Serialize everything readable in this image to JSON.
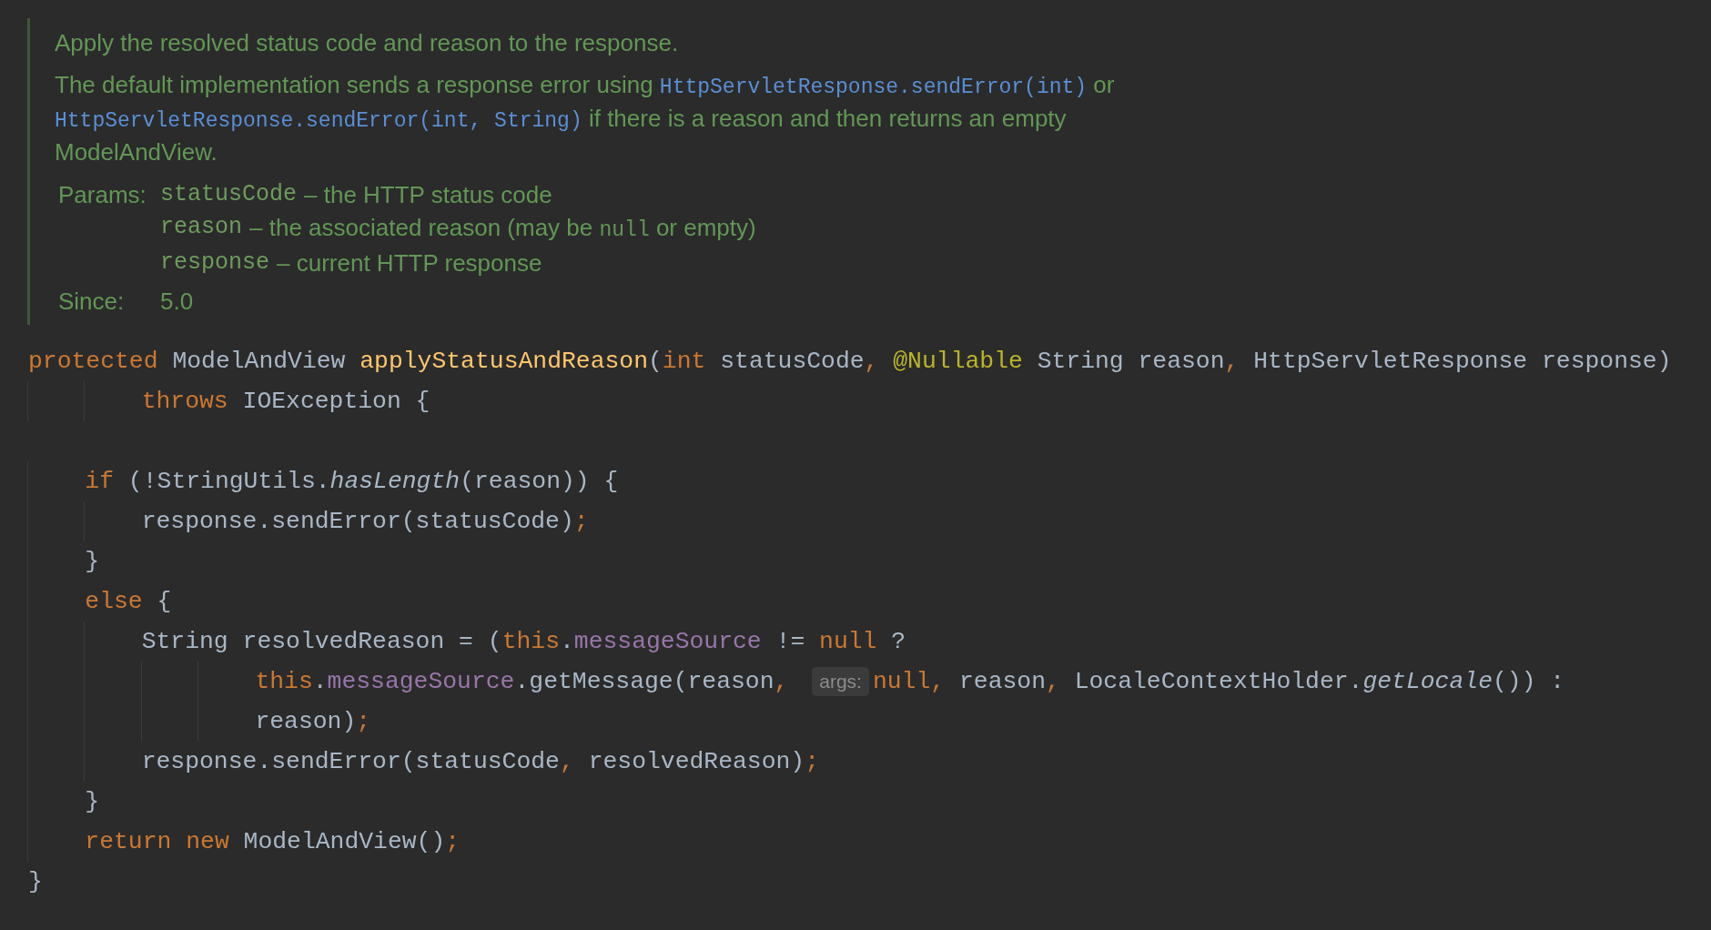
{
  "doc": {
    "summary": "Apply the resolved status code and reason to the response.",
    "description": [
      {
        "kind": "text",
        "text": "The default implementation sends a response error using "
      },
      {
        "kind": "link",
        "text": "HttpServletResponse.sendError(int)"
      },
      {
        "kind": "text",
        "text": " or "
      },
      {
        "kind": "link",
        "text": "HttpServletResponse.sendError(int, String)"
      },
      {
        "kind": "text",
        "text": " if there is a reason and then returns an empty ModelAndView."
      }
    ],
    "params_label": "Params:",
    "params": [
      {
        "name": "statusCode",
        "description": [
          {
            "kind": "text",
            "text": "– the HTTP status code"
          }
        ]
      },
      {
        "name": "reason",
        "description": [
          {
            "kind": "text",
            "text": "– the associated reason (may be "
          },
          {
            "kind": "code",
            "text": "null"
          },
          {
            "kind": "text",
            "text": " or empty)"
          }
        ]
      },
      {
        "name": "response",
        "description": [
          {
            "kind": "text",
            "text": "– current HTTP response"
          }
        ]
      }
    ],
    "since_label": "Since:",
    "since": "5.0"
  },
  "code_lines": [
    {
      "kind": "code",
      "tokens": [
        {
          "kind": "keyword",
          "text": "protected"
        },
        {
          "kind": "plain",
          "text": " ModelAndView "
        },
        {
          "kind": "declaration",
          "text": "applyStatusAndReason"
        },
        {
          "kind": "plain",
          "text": "("
        },
        {
          "kind": "keyword",
          "text": "int"
        },
        {
          "kind": "plain",
          "text": " statusCode"
        },
        {
          "kind": "punct",
          "text": ", "
        },
        {
          "kind": "annotation",
          "text": "@Nullable"
        },
        {
          "kind": "plain",
          "text": " String reason"
        },
        {
          "kind": "punct",
          "text": ", "
        },
        {
          "kind": "plain",
          "text": "HttpServletResponse response)"
        }
      ]
    },
    {
      "kind": "code",
      "tokens": [
        {
          "kind": "keyword",
          "text": "        throws"
        },
        {
          "kind": "plain",
          "text": " IOException {"
        }
      ]
    },
    {
      "kind": "blank"
    },
    {
      "kind": "code",
      "tokens": [
        {
          "kind": "keyword",
          "text": "    if"
        },
        {
          "kind": "plain",
          "text": " (!StringUtils."
        },
        {
          "kind": "static",
          "text": "hasLength"
        },
        {
          "kind": "plain",
          "text": "(reason)) {"
        }
      ]
    },
    {
      "kind": "code",
      "tokens": [
        {
          "kind": "plain",
          "text": "        response.sendError(statusCode)"
        },
        {
          "kind": "punct",
          "text": ";"
        }
      ]
    },
    {
      "kind": "code",
      "tokens": [
        {
          "kind": "plain",
          "text": "    }"
        }
      ]
    },
    {
      "kind": "code",
      "tokens": [
        {
          "kind": "keyword",
          "text": "    else"
        },
        {
          "kind": "plain",
          "text": " {"
        }
      ]
    },
    {
      "kind": "code",
      "tokens": [
        {
          "kind": "plain",
          "text": "        String resolvedReason = ("
        },
        {
          "kind": "keyword",
          "text": "this"
        },
        {
          "kind": "plain",
          "text": "."
        },
        {
          "kind": "field",
          "text": "messageSource"
        },
        {
          "kind": "plain",
          "text": " != "
        },
        {
          "kind": "keyword",
          "text": "null"
        },
        {
          "kind": "plain",
          "text": " ?"
        }
      ]
    },
    {
      "kind": "code",
      "tokens": [
        {
          "kind": "keyword",
          "text": "                this"
        },
        {
          "kind": "plain",
          "text": "."
        },
        {
          "kind": "field",
          "text": "messageSource"
        },
        {
          "kind": "plain",
          "text": ".getMessage(reason"
        },
        {
          "kind": "punct",
          "text": ", "
        },
        {
          "kind": "hint",
          "text": "args:"
        },
        {
          "kind": "keyword",
          "text": "null"
        },
        {
          "kind": "punct",
          "text": ", "
        },
        {
          "kind": "plain",
          "text": "reason"
        },
        {
          "kind": "punct",
          "text": ", "
        },
        {
          "kind": "plain",
          "text": "LocaleContextHolder."
        },
        {
          "kind": "static",
          "text": "getLocale"
        },
        {
          "kind": "plain",
          "text": "()) :"
        }
      ]
    },
    {
      "kind": "code",
      "tokens": [
        {
          "kind": "plain",
          "text": "                reason)"
        },
        {
          "kind": "punct",
          "text": ";"
        }
      ]
    },
    {
      "kind": "code",
      "tokens": [
        {
          "kind": "plain",
          "text": "        response.sendError(statusCode"
        },
        {
          "kind": "punct",
          "text": ", "
        },
        {
          "kind": "plain",
          "text": "resolvedReason)"
        },
        {
          "kind": "punct",
          "text": ";"
        }
      ]
    },
    {
      "kind": "code",
      "tokens": [
        {
          "kind": "plain",
          "text": "    }"
        }
      ]
    },
    {
      "kind": "code",
      "tokens": [
        {
          "kind": "keyword",
          "text": "    return new"
        },
        {
          "kind": "plain",
          "text": " ModelAndView()"
        },
        {
          "kind": "punct",
          "text": ";"
        }
      ]
    },
    {
      "kind": "code",
      "tokens": [
        {
          "kind": "plain",
          "text": "}"
        }
      ]
    }
  ]
}
